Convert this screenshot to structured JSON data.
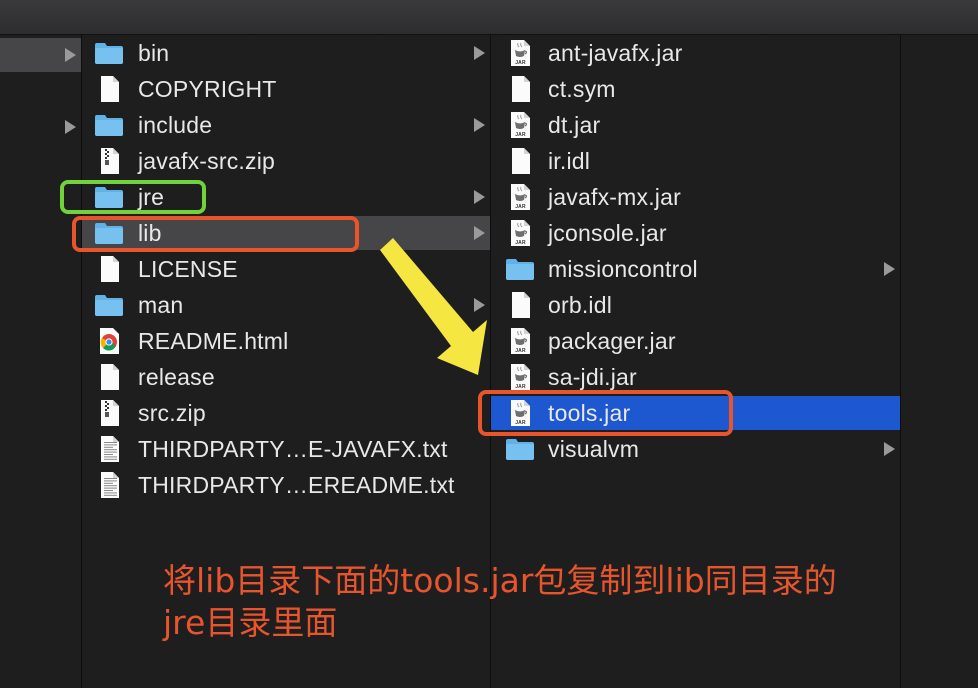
{
  "window": {
    "toolbar": ""
  },
  "column_lib_parent": {
    "items": [
      {
        "label": "bin",
        "icon": "folder-icon",
        "chevron": true
      },
      {
        "label": "COPYRIGHT",
        "icon": "document-icon",
        "chevron": false
      },
      {
        "label": "include",
        "icon": "folder-icon",
        "chevron": true
      },
      {
        "label": "javafx-src.zip",
        "icon": "zip-icon",
        "chevron": false
      },
      {
        "label": "jre",
        "icon": "folder-icon",
        "chevron": true
      },
      {
        "label": "lib",
        "icon": "folder-icon",
        "chevron": true,
        "selected": true
      },
      {
        "label": "LICENSE",
        "icon": "document-icon",
        "chevron": false
      },
      {
        "label": "man",
        "icon": "folder-icon",
        "chevron": true
      },
      {
        "label": "README.html",
        "icon": "chrome-icon",
        "chevron": false
      },
      {
        "label": "release",
        "icon": "document-icon",
        "chevron": false
      },
      {
        "label": "src.zip",
        "icon": "zip-icon",
        "chevron": false
      },
      {
        "label": "THIRDPARTY…E-JAVAFX.txt",
        "icon": "text-file-icon",
        "chevron": false
      },
      {
        "label": "THIRDPARTY…EREADME.txt",
        "icon": "text-file-icon",
        "chevron": false
      }
    ]
  },
  "column_lib": {
    "items": [
      {
        "label": "ant-javafx.jar",
        "icon": "jar-icon",
        "chevron": false
      },
      {
        "label": "ct.sym",
        "icon": "document-icon",
        "chevron": false
      },
      {
        "label": "dt.jar",
        "icon": "jar-icon",
        "chevron": false
      },
      {
        "label": "ir.idl",
        "icon": "document-icon",
        "chevron": false
      },
      {
        "label": "javafx-mx.jar",
        "icon": "jar-icon",
        "chevron": false
      },
      {
        "label": "jconsole.jar",
        "icon": "jar-icon",
        "chevron": false
      },
      {
        "label": "missioncontrol",
        "icon": "folder-icon",
        "chevron": true
      },
      {
        "label": "orb.idl",
        "icon": "document-icon",
        "chevron": false
      },
      {
        "label": "packager.jar",
        "icon": "jar-icon",
        "chevron": false
      },
      {
        "label": "sa-jdi.jar",
        "icon": "jar-icon",
        "chevron": false
      },
      {
        "label": "tools.jar",
        "icon": "jar-icon",
        "chevron": false,
        "selected": true
      },
      {
        "label": "visualvm",
        "icon": "folder-icon",
        "chevron": true
      }
    ]
  },
  "jar_badge": "JAR",
  "annotation": {
    "line1": "将lib目录下面的tools.jar包复制到lib同目录的",
    "line2": "jre目录里面",
    "color": "#e8552d",
    "highlight_jre_color": "#72d23c",
    "arrow_color": "#f5e642"
  },
  "colors": {
    "background": "#1e1e1e",
    "selection_blue": "#1d58d0",
    "selection_gray": "#464649",
    "folder": "#5fb1e6"
  }
}
